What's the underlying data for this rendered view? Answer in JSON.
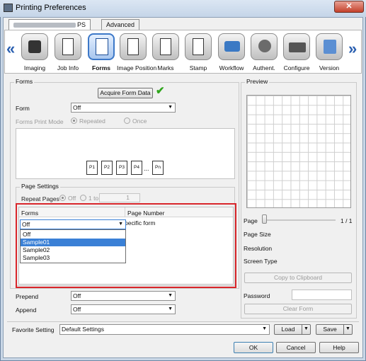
{
  "window": {
    "title": "Printing Preferences",
    "close_label": "✕"
  },
  "tabs": {
    "driver_tab_suffix": "PS",
    "advanced": "Advanced"
  },
  "toolbar": {
    "left_arrow": "«",
    "right_arrow": "»",
    "items": [
      {
        "label": "Imaging"
      },
      {
        "label": "Job Info"
      },
      {
        "label": "Forms"
      },
      {
        "label": "Image Position"
      },
      {
        "label": "Marks"
      },
      {
        "label": "Stamp"
      },
      {
        "label": "Workflow"
      },
      {
        "label": "Authent."
      },
      {
        "label": "Configure"
      },
      {
        "label": "Version"
      }
    ]
  },
  "forms_group": {
    "title": "Forms",
    "acquire_button": "Acquire Form Data",
    "form_label": "Form",
    "form_value": "Off",
    "print_mode_label": "Forms Print Mode",
    "repeated_label": "Repeated",
    "once_label": "Once",
    "pages": [
      "P1",
      "P2",
      "P3",
      "P4",
      "...",
      "Pn"
    ]
  },
  "page_settings": {
    "title": "Page Settings",
    "repeat_pages_label": "Repeat Pages",
    "off_label": "Off",
    "one_to_label": "1 to",
    "spinner_value": "1",
    "col_forms": "Forms",
    "col_page_number": "Page Number",
    "row_select_value": "Off",
    "row_page_text": "pecific form",
    "dropdown_options": [
      "Off",
      "Sample01",
      "Sample02",
      "Sample03"
    ]
  },
  "lower": {
    "prepend_label": "Prepend",
    "prepend_value": "Off",
    "append_label": "Append",
    "append_value": "Off"
  },
  "preview": {
    "title": "Preview",
    "page_label": "Page",
    "page_count": "1 / 1",
    "page_size_label": "Page Size",
    "resolution_label": "Resolution",
    "screen_type_label": "Screen Type",
    "copy_button": "Copy to Clipboard",
    "password_label": "Password",
    "clear_form_button": "Clear Form"
  },
  "footer": {
    "favorite_label": "Favorite Setting",
    "favorite_value": "Default Settings",
    "load_button": "Load",
    "save_button": "Save",
    "ok_button": "OK",
    "cancel_button": "Cancel",
    "help_button": "Help"
  },
  "colors": {
    "accent": "#3c78c8",
    "highlight_border": "#d9262b",
    "check": "#2fa51c"
  }
}
